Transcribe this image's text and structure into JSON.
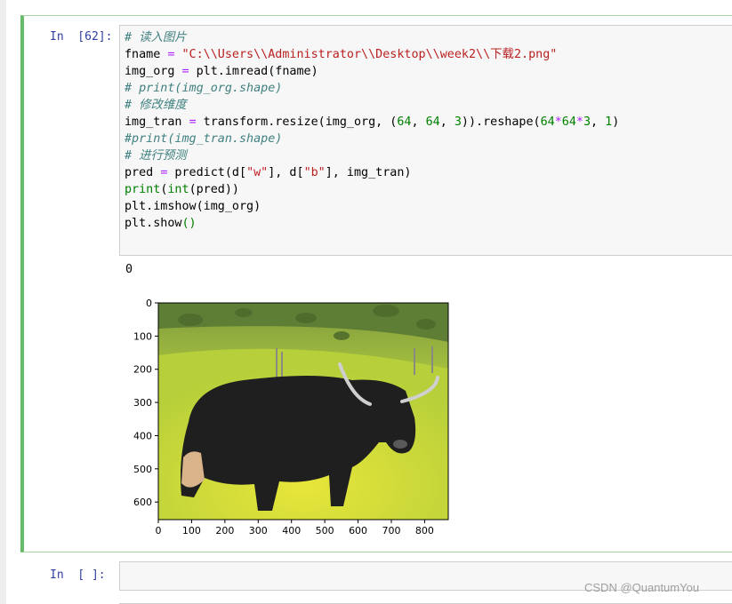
{
  "cells": [
    {
      "prompt": "In  [62]:",
      "code_lines": [
        {
          "tokens": [
            {
              "t": "# 读入图片",
              "c": "comment"
            }
          ]
        },
        {
          "tokens": [
            {
              "t": "fname "
            },
            {
              "t": "=",
              "c": "op"
            },
            {
              "t": " "
            },
            {
              "t": "\"C:\\\\Users\\\\Administrator\\\\Desktop\\\\week2\\\\下载2.png\"",
              "c": "string"
            }
          ]
        },
        {
          "tokens": [
            {
              "t": "img_org "
            },
            {
              "t": "=",
              "c": "op"
            },
            {
              "t": " plt.imread(fname)"
            }
          ]
        },
        {
          "tokens": [
            {
              "t": "# print(img_org.shape)",
              "c": "comment"
            }
          ]
        },
        {
          "tokens": [
            {
              "t": "# 修改维度",
              "c": "comment"
            }
          ]
        },
        {
          "tokens": [
            {
              "t": "img_tran "
            },
            {
              "t": "=",
              "c": "op"
            },
            {
              "t": " transform.resize(img_org, ("
            },
            {
              "t": "64",
              "c": "number"
            },
            {
              "t": ", "
            },
            {
              "t": "64",
              "c": "number"
            },
            {
              "t": ", "
            },
            {
              "t": "3",
              "c": "number"
            },
            {
              "t": ")).reshape("
            },
            {
              "t": "64",
              "c": "number"
            },
            {
              "t": "*",
              "c": "op"
            },
            {
              "t": "64",
              "c": "number"
            },
            {
              "t": "*",
              "c": "op"
            },
            {
              "t": "3",
              "c": "number"
            },
            {
              "t": ", "
            },
            {
              "t": "1",
              "c": "number"
            },
            {
              "t": ")"
            }
          ]
        },
        {
          "tokens": [
            {
              "t": "#print(img_tran.shape)",
              "c": "comment"
            }
          ]
        },
        {
          "tokens": [
            {
              "t": "# 进行预测",
              "c": "comment"
            }
          ]
        },
        {
          "tokens": [
            {
              "t": "pred "
            },
            {
              "t": "=",
              "c": "op"
            },
            {
              "t": " predict(d["
            },
            {
              "t": "\"w\"",
              "c": "string"
            },
            {
              "t": "], d["
            },
            {
              "t": "\"b\"",
              "c": "string"
            },
            {
              "t": "], img_tran)"
            }
          ]
        },
        {
          "tokens": [
            {
              "t": "print",
              "c": "builtin"
            },
            {
              "t": "("
            },
            {
              "t": "int",
              "c": "builtin"
            },
            {
              "t": "(pred))"
            }
          ]
        },
        {
          "tokens": [
            {
              "t": "plt.imshow(img_org)"
            }
          ]
        },
        {
          "tokens": [
            {
              "t": "plt.show"
            },
            {
              "t": "()",
              "c": "builtin"
            }
          ]
        }
      ],
      "stdout": "0",
      "plot": {
        "x_ticks": [
          "0",
          "100",
          "200",
          "300",
          "400",
          "500",
          "600",
          "700",
          "800"
        ],
        "y_ticks": [
          "0",
          "100",
          "200",
          "300",
          "400",
          "500",
          "600"
        ],
        "image_subject": "yak-photo"
      }
    },
    {
      "prompt": "In  [ ]:"
    }
  ],
  "watermark": "CSDN @QuantumYou"
}
